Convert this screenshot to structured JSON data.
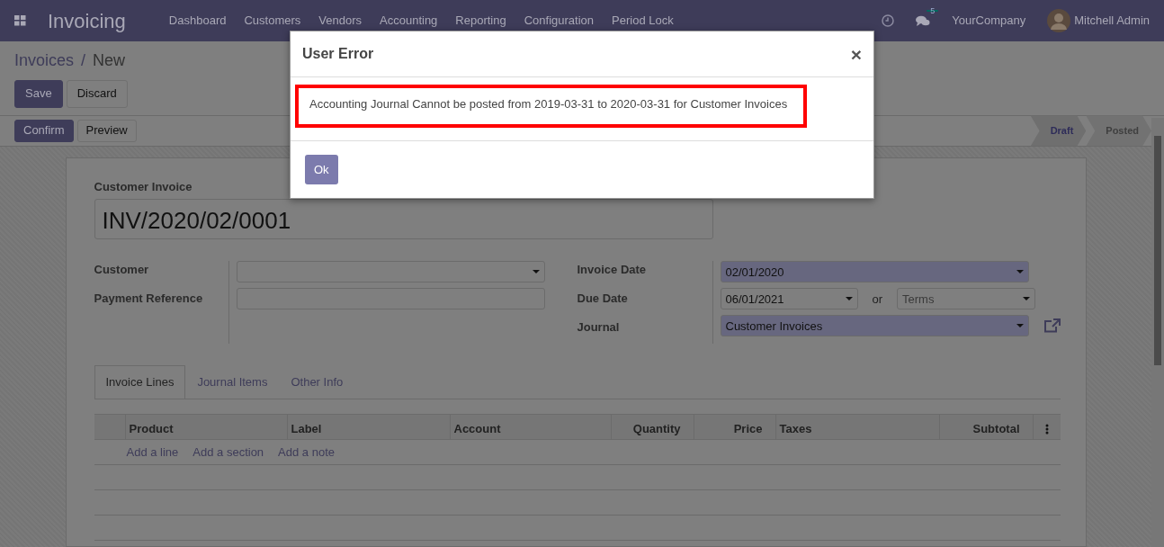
{
  "navbar": {
    "app_name": "Invoicing",
    "menu": [
      "Dashboard",
      "Customers",
      "Vendors",
      "Accounting",
      "Reporting",
      "Configuration",
      "Period Lock"
    ],
    "messages_badge": "5",
    "company": "YourCompany",
    "user": "Mitchell Admin"
  },
  "breadcrumb": {
    "items": [
      "Invoices",
      "New"
    ],
    "separator": "/"
  },
  "buttons": [
    {
      "label": "Save",
      "kind": "primary"
    },
    {
      "label": "Discard",
      "kind": "secondary"
    }
  ],
  "actions": [
    {
      "label": "Confirm",
      "kind": "primary"
    },
    {
      "label": "Preview",
      "kind": "secondary"
    }
  ],
  "status": [
    {
      "label": "Draft",
      "selected": true
    },
    {
      "label": "Posted",
      "selected": false
    }
  ],
  "form": {
    "title_label": "Customer Invoice",
    "number": "INV/2020/02/0001",
    "left_fields": [
      {
        "label": "Customer",
        "kind": "select"
      },
      {
        "label": "Payment Reference",
        "kind": "input"
      }
    ],
    "right_fields": [
      {
        "label": "Invoice Date",
        "kind": "select",
        "value": "02/01/2020",
        "required": true
      },
      {
        "label": "Due Date",
        "kind": "due",
        "value": "06/01/2021",
        "or": "or",
        "placeholder": "Terms"
      },
      {
        "label": "Journal",
        "kind": "select",
        "value": "Customer Invoices",
        "required": true,
        "external_link": true
      }
    ]
  },
  "tabs": [
    {
      "label": "Invoice Lines",
      "selected": true
    },
    {
      "label": "Journal Items",
      "selected": false
    },
    {
      "label": "Other Info",
      "selected": false
    }
  ],
  "table": {
    "columns": [
      {
        "label": "Product",
        "kind": "text"
      },
      {
        "label": "Label",
        "kind": "text"
      },
      {
        "label": "Account",
        "kind": "text"
      },
      {
        "label": "Quantity",
        "kind": "number"
      },
      {
        "label": "Price",
        "kind": "number"
      },
      {
        "label": "Taxes",
        "kind": "text"
      },
      {
        "label": "Subtotal",
        "kind": "number"
      }
    ],
    "add_links": [
      "Add a line",
      "Add a section",
      "Add a note"
    ]
  },
  "dialog": {
    "title": "User Error",
    "close": "×",
    "message": "Accounting Journal Cannot be posted from 2019-03-31 to 2020-03-31 for Customer Invoices",
    "button": "Ok"
  }
}
